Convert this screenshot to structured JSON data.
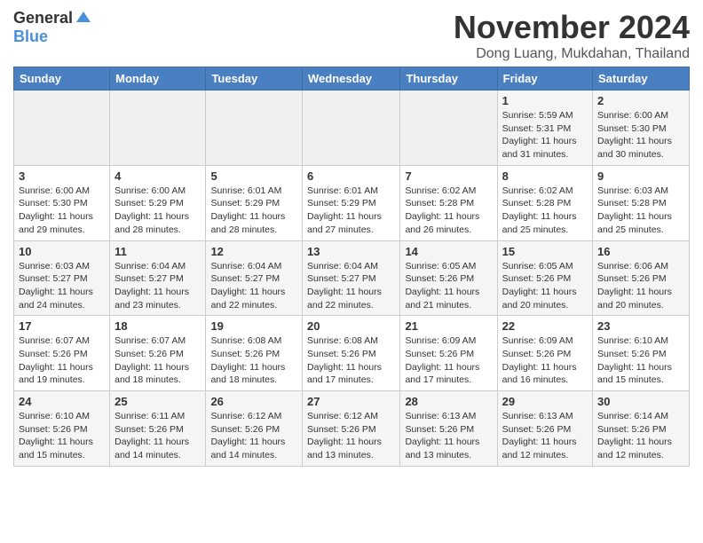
{
  "header": {
    "logo_general": "General",
    "logo_blue": "Blue",
    "month_title": "November 2024",
    "subtitle": "Dong Luang, Mukdahan, Thailand"
  },
  "weekdays": [
    "Sunday",
    "Monday",
    "Tuesday",
    "Wednesday",
    "Thursday",
    "Friday",
    "Saturday"
  ],
  "weeks": [
    [
      {
        "day": "",
        "info": ""
      },
      {
        "day": "",
        "info": ""
      },
      {
        "day": "",
        "info": ""
      },
      {
        "day": "",
        "info": ""
      },
      {
        "day": "",
        "info": ""
      },
      {
        "day": "1",
        "info": "Sunrise: 5:59 AM\nSunset: 5:31 PM\nDaylight: 11 hours and 31 minutes."
      },
      {
        "day": "2",
        "info": "Sunrise: 6:00 AM\nSunset: 5:30 PM\nDaylight: 11 hours and 30 minutes."
      }
    ],
    [
      {
        "day": "3",
        "info": "Sunrise: 6:00 AM\nSunset: 5:30 PM\nDaylight: 11 hours and 29 minutes."
      },
      {
        "day": "4",
        "info": "Sunrise: 6:00 AM\nSunset: 5:29 PM\nDaylight: 11 hours and 28 minutes."
      },
      {
        "day": "5",
        "info": "Sunrise: 6:01 AM\nSunset: 5:29 PM\nDaylight: 11 hours and 28 minutes."
      },
      {
        "day": "6",
        "info": "Sunrise: 6:01 AM\nSunset: 5:29 PM\nDaylight: 11 hours and 27 minutes."
      },
      {
        "day": "7",
        "info": "Sunrise: 6:02 AM\nSunset: 5:28 PM\nDaylight: 11 hours and 26 minutes."
      },
      {
        "day": "8",
        "info": "Sunrise: 6:02 AM\nSunset: 5:28 PM\nDaylight: 11 hours and 25 minutes."
      },
      {
        "day": "9",
        "info": "Sunrise: 6:03 AM\nSunset: 5:28 PM\nDaylight: 11 hours and 25 minutes."
      }
    ],
    [
      {
        "day": "10",
        "info": "Sunrise: 6:03 AM\nSunset: 5:27 PM\nDaylight: 11 hours and 24 minutes."
      },
      {
        "day": "11",
        "info": "Sunrise: 6:04 AM\nSunset: 5:27 PM\nDaylight: 11 hours and 23 minutes."
      },
      {
        "day": "12",
        "info": "Sunrise: 6:04 AM\nSunset: 5:27 PM\nDaylight: 11 hours and 22 minutes."
      },
      {
        "day": "13",
        "info": "Sunrise: 6:04 AM\nSunset: 5:27 PM\nDaylight: 11 hours and 22 minutes."
      },
      {
        "day": "14",
        "info": "Sunrise: 6:05 AM\nSunset: 5:26 PM\nDaylight: 11 hours and 21 minutes."
      },
      {
        "day": "15",
        "info": "Sunrise: 6:05 AM\nSunset: 5:26 PM\nDaylight: 11 hours and 20 minutes."
      },
      {
        "day": "16",
        "info": "Sunrise: 6:06 AM\nSunset: 5:26 PM\nDaylight: 11 hours and 20 minutes."
      }
    ],
    [
      {
        "day": "17",
        "info": "Sunrise: 6:07 AM\nSunset: 5:26 PM\nDaylight: 11 hours and 19 minutes."
      },
      {
        "day": "18",
        "info": "Sunrise: 6:07 AM\nSunset: 5:26 PM\nDaylight: 11 hours and 18 minutes."
      },
      {
        "day": "19",
        "info": "Sunrise: 6:08 AM\nSunset: 5:26 PM\nDaylight: 11 hours and 18 minutes."
      },
      {
        "day": "20",
        "info": "Sunrise: 6:08 AM\nSunset: 5:26 PM\nDaylight: 11 hours and 17 minutes."
      },
      {
        "day": "21",
        "info": "Sunrise: 6:09 AM\nSunset: 5:26 PM\nDaylight: 11 hours and 17 minutes."
      },
      {
        "day": "22",
        "info": "Sunrise: 6:09 AM\nSunset: 5:26 PM\nDaylight: 11 hours and 16 minutes."
      },
      {
        "day": "23",
        "info": "Sunrise: 6:10 AM\nSunset: 5:26 PM\nDaylight: 11 hours and 15 minutes."
      }
    ],
    [
      {
        "day": "24",
        "info": "Sunrise: 6:10 AM\nSunset: 5:26 PM\nDaylight: 11 hours and 15 minutes."
      },
      {
        "day": "25",
        "info": "Sunrise: 6:11 AM\nSunset: 5:26 PM\nDaylight: 11 hours and 14 minutes."
      },
      {
        "day": "26",
        "info": "Sunrise: 6:12 AM\nSunset: 5:26 PM\nDaylight: 11 hours and 14 minutes."
      },
      {
        "day": "27",
        "info": "Sunrise: 6:12 AM\nSunset: 5:26 PM\nDaylight: 11 hours and 13 minutes."
      },
      {
        "day": "28",
        "info": "Sunrise: 6:13 AM\nSunset: 5:26 PM\nDaylight: 11 hours and 13 minutes."
      },
      {
        "day": "29",
        "info": "Sunrise: 6:13 AM\nSunset: 5:26 PM\nDaylight: 11 hours and 12 minutes."
      },
      {
        "day": "30",
        "info": "Sunrise: 6:14 AM\nSunset: 5:26 PM\nDaylight: 11 hours and 12 minutes."
      }
    ]
  ]
}
